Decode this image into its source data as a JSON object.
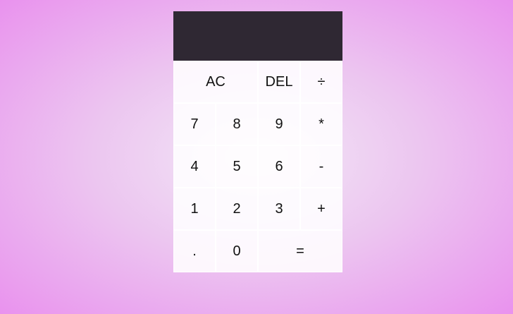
{
  "display": {
    "previous_operand": "",
    "current_operand": ""
  },
  "keys": {
    "all_clear": "AC",
    "delete": "DEL",
    "divide": "÷",
    "seven": "7",
    "eight": "8",
    "nine": "9",
    "multiply": "*",
    "four": "4",
    "five": "5",
    "six": "6",
    "subtract": "-",
    "one": "1",
    "two": "2",
    "three": "3",
    "add": "+",
    "decimal": ".",
    "zero": "0",
    "equals": "="
  },
  "colors": {
    "display_background": "#2f2833",
    "page_gradient_center": "#f3e8f7",
    "page_gradient_edge": "#e992ee",
    "key_background": "#fbf2fc"
  }
}
